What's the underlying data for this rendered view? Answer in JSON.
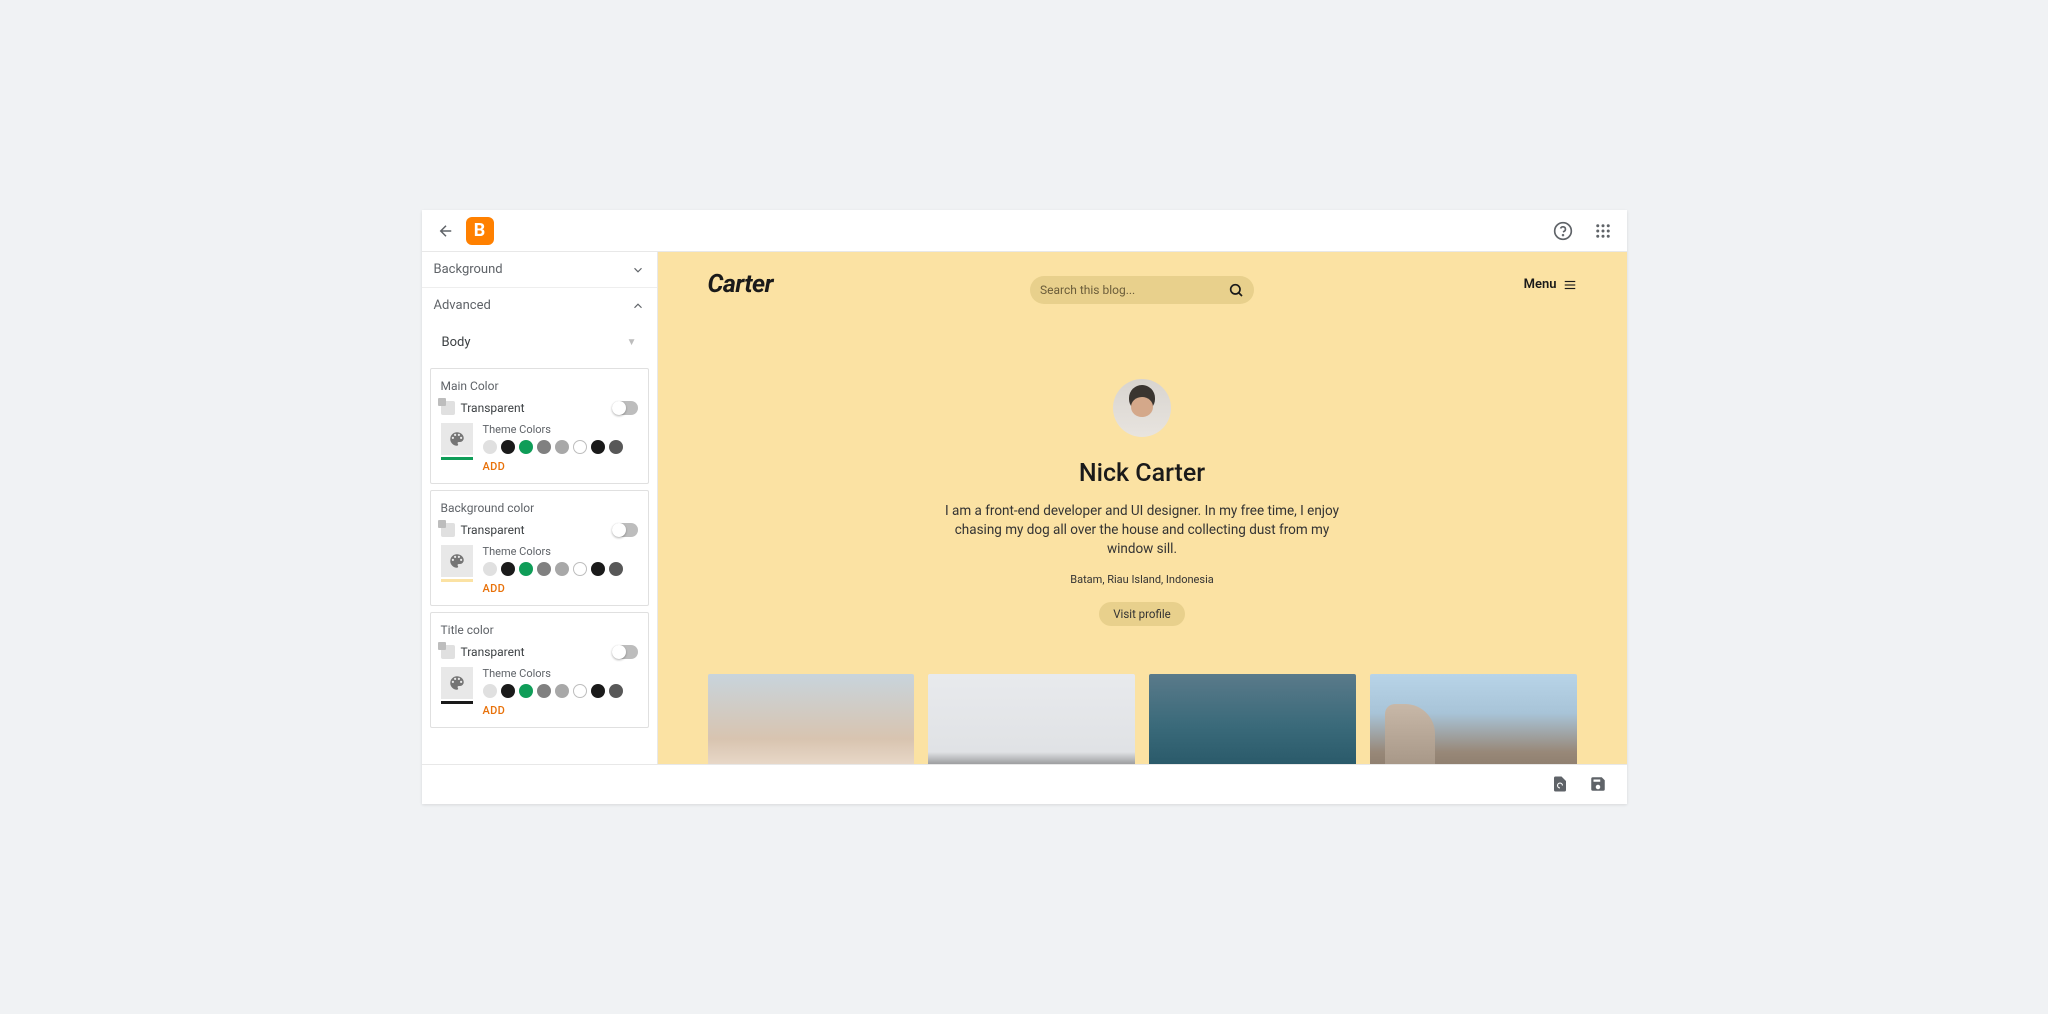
{
  "header": {
    "logo_letter": "B"
  },
  "sidebar": {
    "background_section": "Background",
    "advanced_section": "Advanced",
    "dropdown_value": "Body",
    "cards": [
      {
        "title": "Main Color",
        "underline": "#0f9d58"
      },
      {
        "title": "Background color",
        "underline": "#fbe2a3"
      },
      {
        "title": "Title color",
        "underline": "#1a1a1a"
      }
    ],
    "transparent_label": "Transparent",
    "theme_colors_label": "Theme Colors",
    "add_label": "ADD",
    "swatches": [
      "#e0e0e0",
      "#1a1a1a",
      "#0f9d58",
      "#808080",
      "#a8a8a8",
      "hollow",
      "#1a1a1a",
      "#585858"
    ]
  },
  "preview": {
    "blog_title": "Carter",
    "search_placeholder": "Search this blog...",
    "menu_label": "Menu",
    "profile_name": "Nick Carter",
    "bio": "I am a front-end developer and UI designer. In my free time, I enjoy chasing my dog all over the house and collecting dust from my window sill.",
    "location": "Batam, Riau Island, Indonesia",
    "visit_label": "Visit profile"
  }
}
